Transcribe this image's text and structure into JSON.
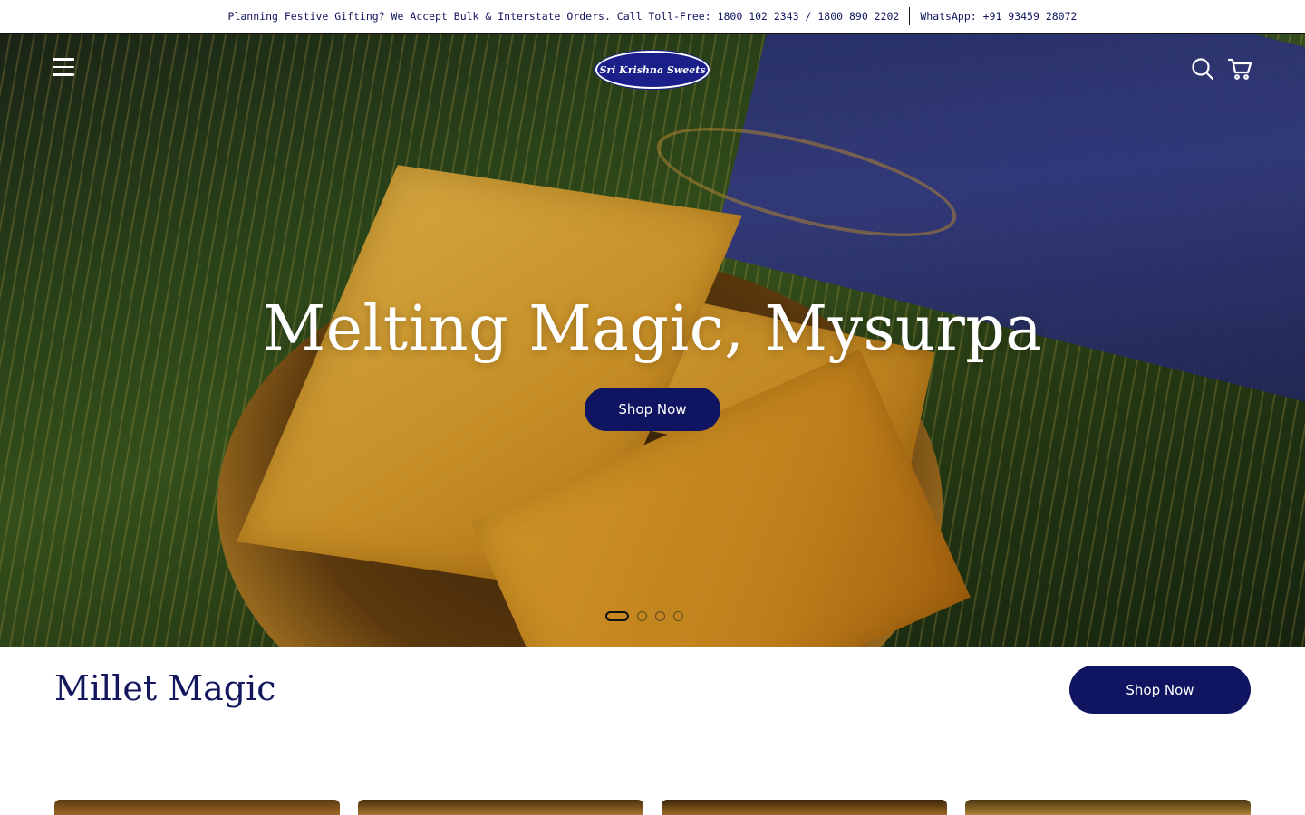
{
  "announcement": {
    "left_text": "Planning Festive Gifting? We Accept Bulk & Interstate Orders. Call Toll-Free: 1800 102 2343 / 1800 890 2202",
    "right_text": "WhatsApp: +91 93459 28072"
  },
  "header": {
    "logo_text": "Sri Krishna Sweets",
    "icons": [
      "menu-icon",
      "search-icon",
      "cart-icon"
    ]
  },
  "hero": {
    "title": "Melting Magic, Mysurpa",
    "button_label": "Shop Now",
    "slides_total": 4,
    "active_slide": 1
  },
  "section": {
    "title": "Millet Magic",
    "button_label": "Shop Now"
  },
  "colors": {
    "brand_navy": "#0f1560",
    "text_navy": "#12175e",
    "white": "#ffffff"
  }
}
